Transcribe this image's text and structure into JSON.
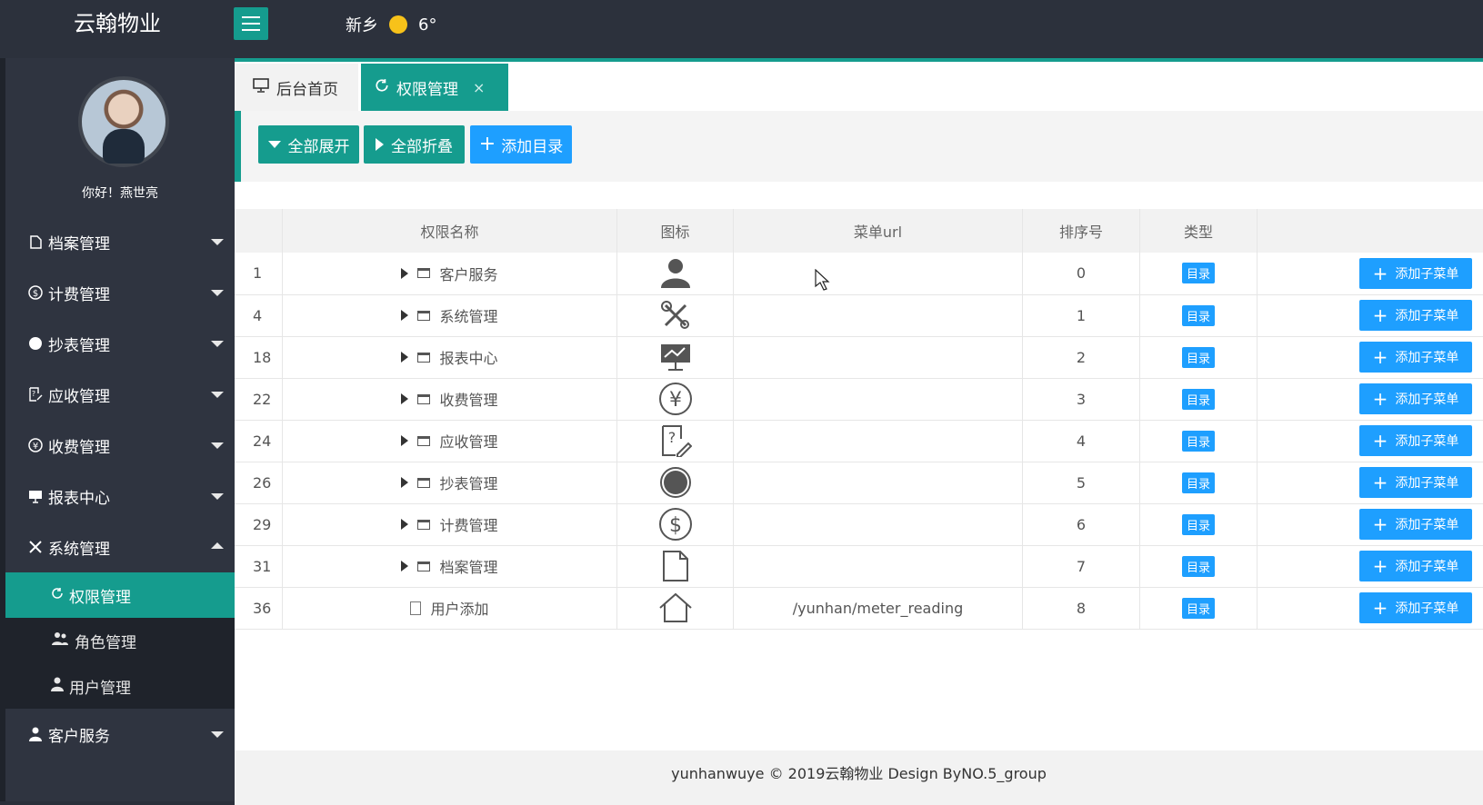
{
  "app": {
    "title": "云翰物业"
  },
  "header": {
    "city": "新乡",
    "temperature": "6°"
  },
  "user": {
    "greeting": "你好！燕世亮"
  },
  "sidebar": {
    "items": [
      {
        "label": "档案管理"
      },
      {
        "label": "计费管理"
      },
      {
        "label": "抄表管理"
      },
      {
        "label": "应收管理"
      },
      {
        "label": "收费管理"
      },
      {
        "label": "报表中心"
      },
      {
        "label": "系统管理"
      },
      {
        "label": "客户服务"
      }
    ],
    "system_sub": [
      {
        "label": "权限管理"
      },
      {
        "label": "角色管理"
      },
      {
        "label": "用户管理"
      }
    ]
  },
  "tabs": {
    "home": "后台首页",
    "active": "权限管理",
    "close": "×"
  },
  "toolbar": {
    "expand_all": "全部展开",
    "collapse_all": "全部折叠",
    "add_dir": "添加目录"
  },
  "table": {
    "headers": {
      "name": "权限名称",
      "icon": "图标",
      "url": "菜单url",
      "order": "排序号",
      "type": "类型"
    },
    "rows": [
      {
        "id": "1",
        "name": "客户服务",
        "icon": "user-icon",
        "url": "",
        "order": "0",
        "type": "目录",
        "action": "添加子菜单"
      },
      {
        "id": "4",
        "name": "系统管理",
        "icon": "tools-icon",
        "url": "",
        "order": "1",
        "type": "目录",
        "action": "添加子菜单"
      },
      {
        "id": "18",
        "name": "报表中心",
        "icon": "presentation-icon",
        "url": "",
        "order": "2",
        "type": "目录",
        "action": "添加子菜单"
      },
      {
        "id": "22",
        "name": "收费管理",
        "icon": "yen-icon",
        "url": "",
        "order": "3",
        "type": "目录",
        "action": "添加子菜单"
      },
      {
        "id": "24",
        "name": "应收管理",
        "icon": "question-edit-icon",
        "url": "",
        "order": "4",
        "type": "目录",
        "action": "添加子菜单"
      },
      {
        "id": "26",
        "name": "抄表管理",
        "icon": "circle-icon",
        "url": "",
        "order": "5",
        "type": "目录",
        "action": "添加子菜单"
      },
      {
        "id": "29",
        "name": "计费管理",
        "icon": "dollar-icon",
        "url": "",
        "order": "6",
        "type": "目录",
        "action": "添加子菜单"
      },
      {
        "id": "31",
        "name": "档案管理",
        "icon": "document-icon",
        "url": "",
        "order": "7",
        "type": "目录",
        "action": "添加子菜单"
      },
      {
        "id": "36",
        "name": "用户添加",
        "icon": "home-icon",
        "url": "/yunhan/meter_reading",
        "order": "8",
        "type": "目录",
        "action": "添加子菜单"
      }
    ]
  },
  "footer": {
    "text": "yunhanwuye © 2019云翰物业 Design ByNO.5_group"
  },
  "colors": {
    "accent": "#159c8e",
    "primary_blue": "#1e9fff",
    "sidebar_bg": "#2f3440",
    "topbar_bg": "#2c313c"
  }
}
